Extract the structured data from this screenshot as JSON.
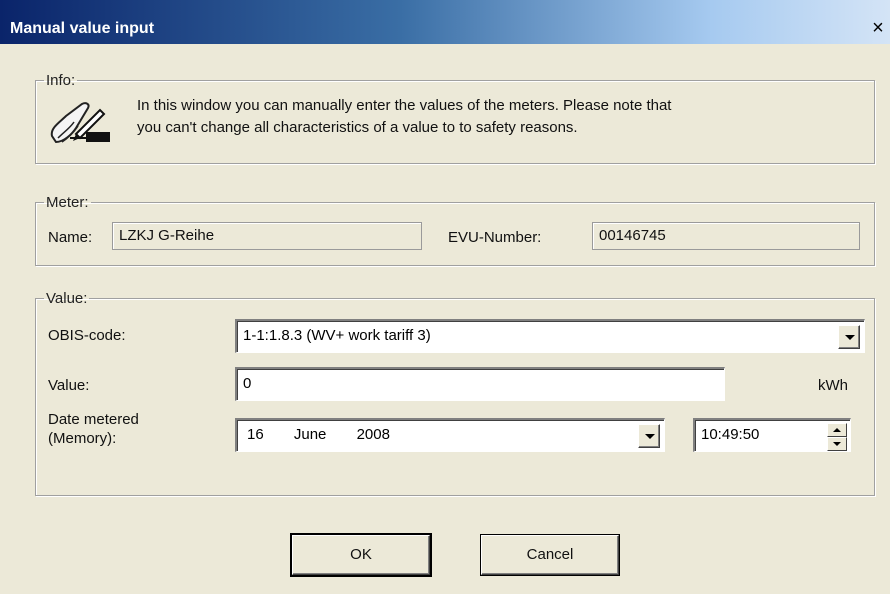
{
  "window": {
    "title": "Manual value input",
    "close_symbol": "×"
  },
  "info_group": {
    "legend": "Info:",
    "icon": "pen-on-paper-icon",
    "text_line1": "In this window you can manually enter the values of the meters. Please note that",
    "text_line2": "you can't change all characteristics of a value to to safety reasons."
  },
  "meter_group": {
    "legend": "Meter:",
    "name_label": "Name:",
    "name_value": "LZKJ G-Reihe",
    "evu_label": "EVU-Number:",
    "evu_value": "00146745"
  },
  "value_group": {
    "legend": "Value:",
    "obis_label": "OBIS-code:",
    "obis_selected": "1-1:1.8.3  (WV+ work tariff 3)",
    "value_label": "Value:",
    "value_input": "0",
    "value_unit": "kWh",
    "date_label_line1": "Date metered",
    "date_label_line2": "(Memory):",
    "date_day": "16",
    "date_month": "June",
    "date_year": "2008",
    "time_value": "10:49:50"
  },
  "buttons": {
    "ok": "OK",
    "cancel": "Cancel"
  },
  "colors": {
    "titlebar_start": "#0a246a",
    "titlebar_end": "#d4e4f6",
    "dialog_bg": "#ece9d8"
  }
}
